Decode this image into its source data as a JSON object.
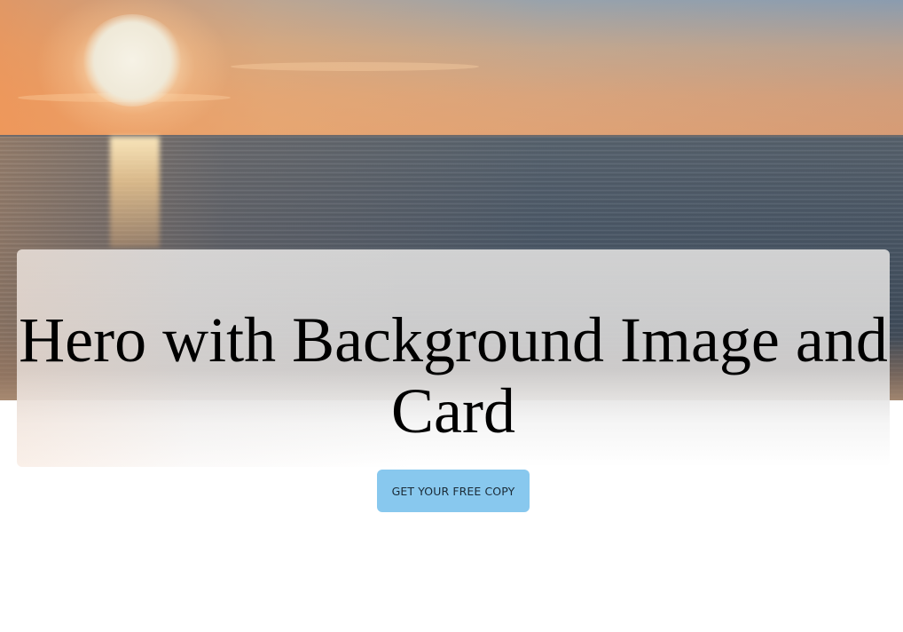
{
  "hero": {
    "title": "Hero with Background Image and Card",
    "background_description_colors": {
      "sky": "#e6a273",
      "sea": "#485462",
      "card": "#d6d6d6"
    }
  },
  "cta": {
    "label": "GET YOUR FREE COPY",
    "color": "#88c8ee"
  }
}
